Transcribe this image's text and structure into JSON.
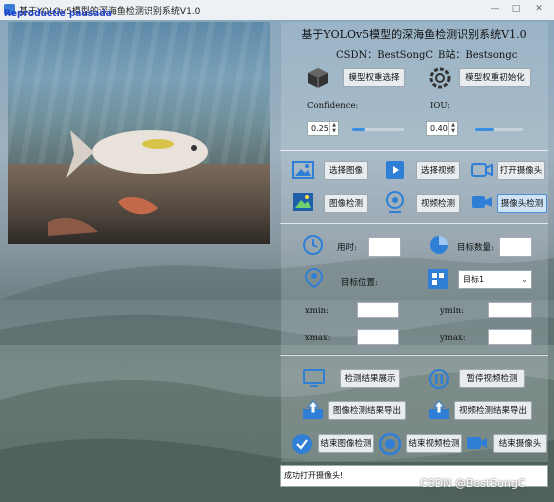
{
  "window": {
    "title": "基于YOLOv5模型的深海鱼检测识别系统V1.0",
    "watermark": "Reproductie pausada",
    "minimize": "—",
    "maximize": "□",
    "close": "✕"
  },
  "header": {
    "title": "基于YOLOv5模型的深海鱼检测识别系统V1.0",
    "csdn": "CSDN：BestSongC",
    "bilibili": "B站：Bestsongc"
  },
  "model": {
    "select_weights": "模型权重选择",
    "init_weights": "模型权重初始化"
  },
  "params": {
    "confidence_label": "Confidence:",
    "iou_label": "IOU:",
    "confidence_value": "0.25",
    "iou_value": "0.40",
    "confidence_fill": 0.25,
    "iou_fill": 0.4
  },
  "sources": {
    "select_image": "选择图像",
    "select_video": "选择视频",
    "open_camera": "打开摄像头",
    "image_detect": "图像检测",
    "video_detect": "视频检测",
    "camera_detect": "摄像头检测"
  },
  "info": {
    "time_label": "用时:",
    "count_label": "目标数量:",
    "position_label": "目标位置:",
    "target_select": "目标1",
    "xmin_label": "xmin:",
    "ymin_label": "ymin:",
    "xmax_label": "xmax:",
    "ymax_label": "ymax:"
  },
  "actions": {
    "show_results": "检测结果展示",
    "pause_video": "暂停视频检测",
    "export_image": "图像检测结果导出",
    "export_video": "视频检测结果导出",
    "end_image": "结束图像检测",
    "end_video": "结束视频检测",
    "end_camera": "结束摄像头"
  },
  "status": {
    "message": "成功打开摄像头!"
  },
  "page_watermark": "CSDN @BestSongC",
  "colors": {
    "accent": "#3b8fe0",
    "icon_blue": "#2f7fd6"
  }
}
